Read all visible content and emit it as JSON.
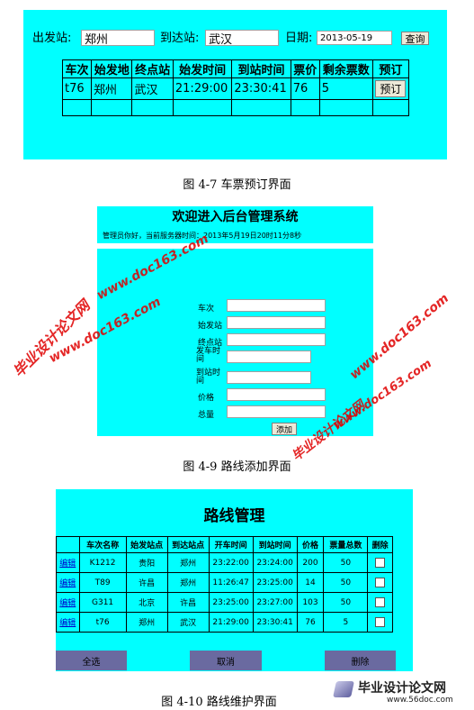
{
  "fig1": {
    "from_label": "出发站:",
    "from_value": "郑州",
    "to_label": "到达站:",
    "to_value": "武汉",
    "date_label": "日期:",
    "date_value": "2013-05-19",
    "query_button": "查询",
    "headers": [
      "车次",
      "始发地",
      "终点站",
      "始发时间",
      "到站时间",
      "票价",
      "剩余票数",
      "预订"
    ],
    "row": [
      "t76",
      "郑州",
      "武汉",
      "21:29:00",
      "23:30:41",
      "76",
      "5"
    ],
    "book_button": "预订",
    "caption": "图 4-7    车票预订界面"
  },
  "fig2": {
    "title": "欢迎进入后台管理系统",
    "subtitle": "管理员你好，当前服务器时间：2013年5月19日20时11分8秒",
    "fields": {
      "train": "车次",
      "from": "始发站",
      "to": "终点站",
      "depart": "发车时间",
      "arrive": "到站时间",
      "price": "价格",
      "total": "总量"
    },
    "add_button": "添加",
    "caption": "图 4-9    路线添加界面"
  },
  "fig3": {
    "title": "路线管理",
    "headers": [
      "",
      "车次名称",
      "始发站点",
      "到达站点",
      "开车时间",
      "到站时间",
      "价格",
      "票量总数",
      "删除"
    ],
    "edit_label": "编辑",
    "rows": [
      [
        "K1212",
        "贵阳",
        "郑州",
        "23:22:00",
        "23:24:00",
        "200",
        "50"
      ],
      [
        "T89",
        "许昌",
        "郑州",
        "11:26:47",
        "23:25:00",
        "14",
        "50"
      ],
      [
        "G311",
        "北京",
        "许昌",
        "23:25:00",
        "23:27:00",
        "103",
        "50"
      ],
      [
        "t76",
        "郑州",
        "武汉",
        "21:29:00",
        "23:30:41",
        "76",
        "5"
      ]
    ],
    "select_all": "全选",
    "cancel": "取消",
    "delete": "删除",
    "caption": "图 4-10    路线维护界面"
  },
  "watermarks": {
    "site": "www.doc163.com",
    "name": "毕业设计论文网",
    "footer_logo_text": "毕业设计论文网",
    "footer_logo_url": "www.56doc.com"
  },
  "colors": {
    "panel": "#00ffff",
    "footer_bar": "#6a6aa0",
    "watermark": "#e00000"
  }
}
